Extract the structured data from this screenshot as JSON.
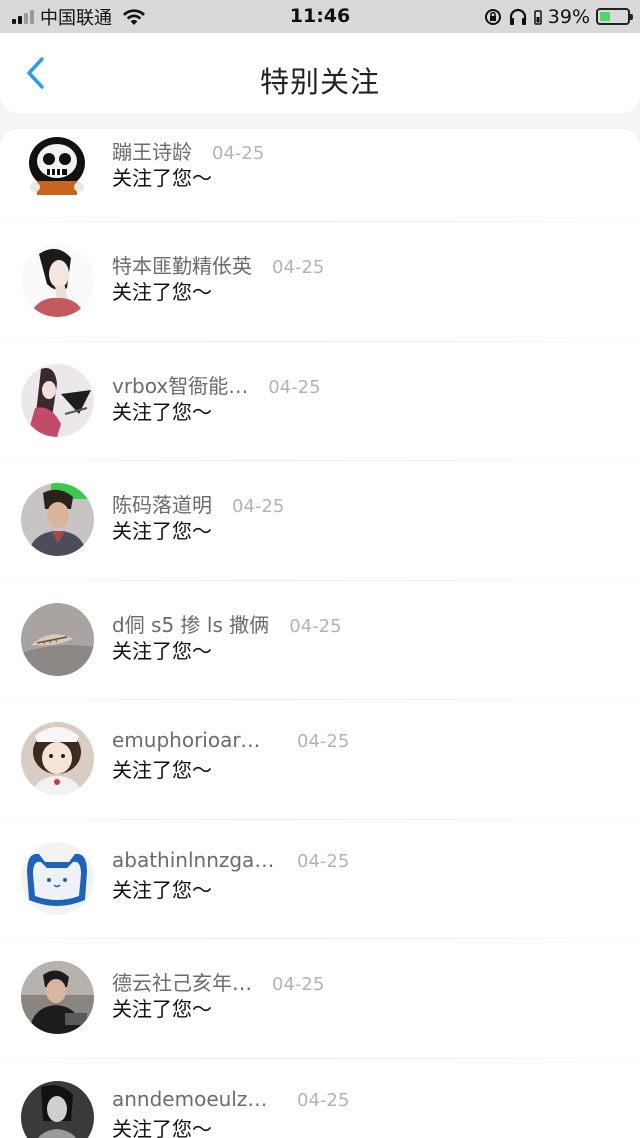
{
  "status_bar": {
    "carrier": "中国联通",
    "time": "11:46",
    "battery_percent": "39%",
    "battery_level": 0.39
  },
  "header": {
    "title": "特别关注",
    "back_icon": "chevron-left-icon"
  },
  "items": [
    {
      "name": "蹦王诗龄",
      "date": "04-25",
      "message": "关注了您～"
    },
    {
      "name": "特本匪勤精伥英",
      "date": "04-25",
      "message": "关注了您～"
    },
    {
      "name": "vrbox智衙能…",
      "date": "04-25",
      "message": "关注了您～"
    },
    {
      "name": "陈码落道明",
      "date": "04-25",
      "message": "关注了您～"
    },
    {
      "name": "d侗 s5 掺 ls 撒俩",
      "date": "04-25",
      "message": "关注了您～"
    },
    {
      "name": "emuphorioarm...",
      "date": "04-25",
      "message": "关注了您～"
    },
    {
      "name": "abathinlnnzgape",
      "date": "04-25",
      "message": "关注了您～"
    },
    {
      "name": "德云社己亥年…",
      "date": "04-25",
      "message": "关注了您～"
    },
    {
      "name": "anndemoeulze...",
      "date": "04-25",
      "message": "关注了您～"
    }
  ],
  "colors": {
    "accent": "#2a9de8",
    "name_text": "#6b6b6b",
    "date_text": "#b3b3b3",
    "battery_fill": "#4cd964"
  }
}
